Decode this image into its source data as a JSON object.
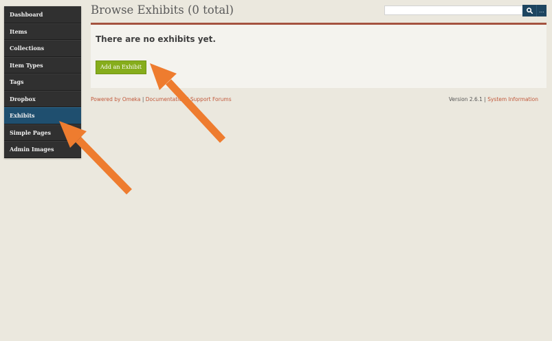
{
  "sidebar": {
    "items": [
      {
        "label": "Dashboard"
      },
      {
        "label": "Items"
      },
      {
        "label": "Collections"
      },
      {
        "label": "Item Types"
      },
      {
        "label": "Tags"
      },
      {
        "label": "Dropbox"
      },
      {
        "label": "Exhibits",
        "active": true
      },
      {
        "label": "Simple Pages"
      },
      {
        "label": "Admin Images"
      }
    ]
  },
  "header": {
    "title": "Browse Exhibits (0 total)",
    "search_placeholder": "",
    "search_icon": "search-icon",
    "search_options_label": "..."
  },
  "main": {
    "empty_message": "There are no exhibits yet.",
    "add_button_label": "Add an Exhibit"
  },
  "footer": {
    "powered_by": "Powered by Omeka",
    "sep1": " | ",
    "documentation": "Documentation",
    "sep2": " | ",
    "support_forums": "Support Forums",
    "version": "Version 2.6.1",
    "sep3": " | ",
    "system_info": "System Information"
  },
  "colors": {
    "background": "#ebe8de",
    "sidebar": "#303030",
    "active_nav": "#1f4f6f",
    "accent_border": "#a4523f",
    "add_button": "#86ad1c",
    "link": "#c1583a",
    "annotation_arrow": "#ee7c2f"
  }
}
